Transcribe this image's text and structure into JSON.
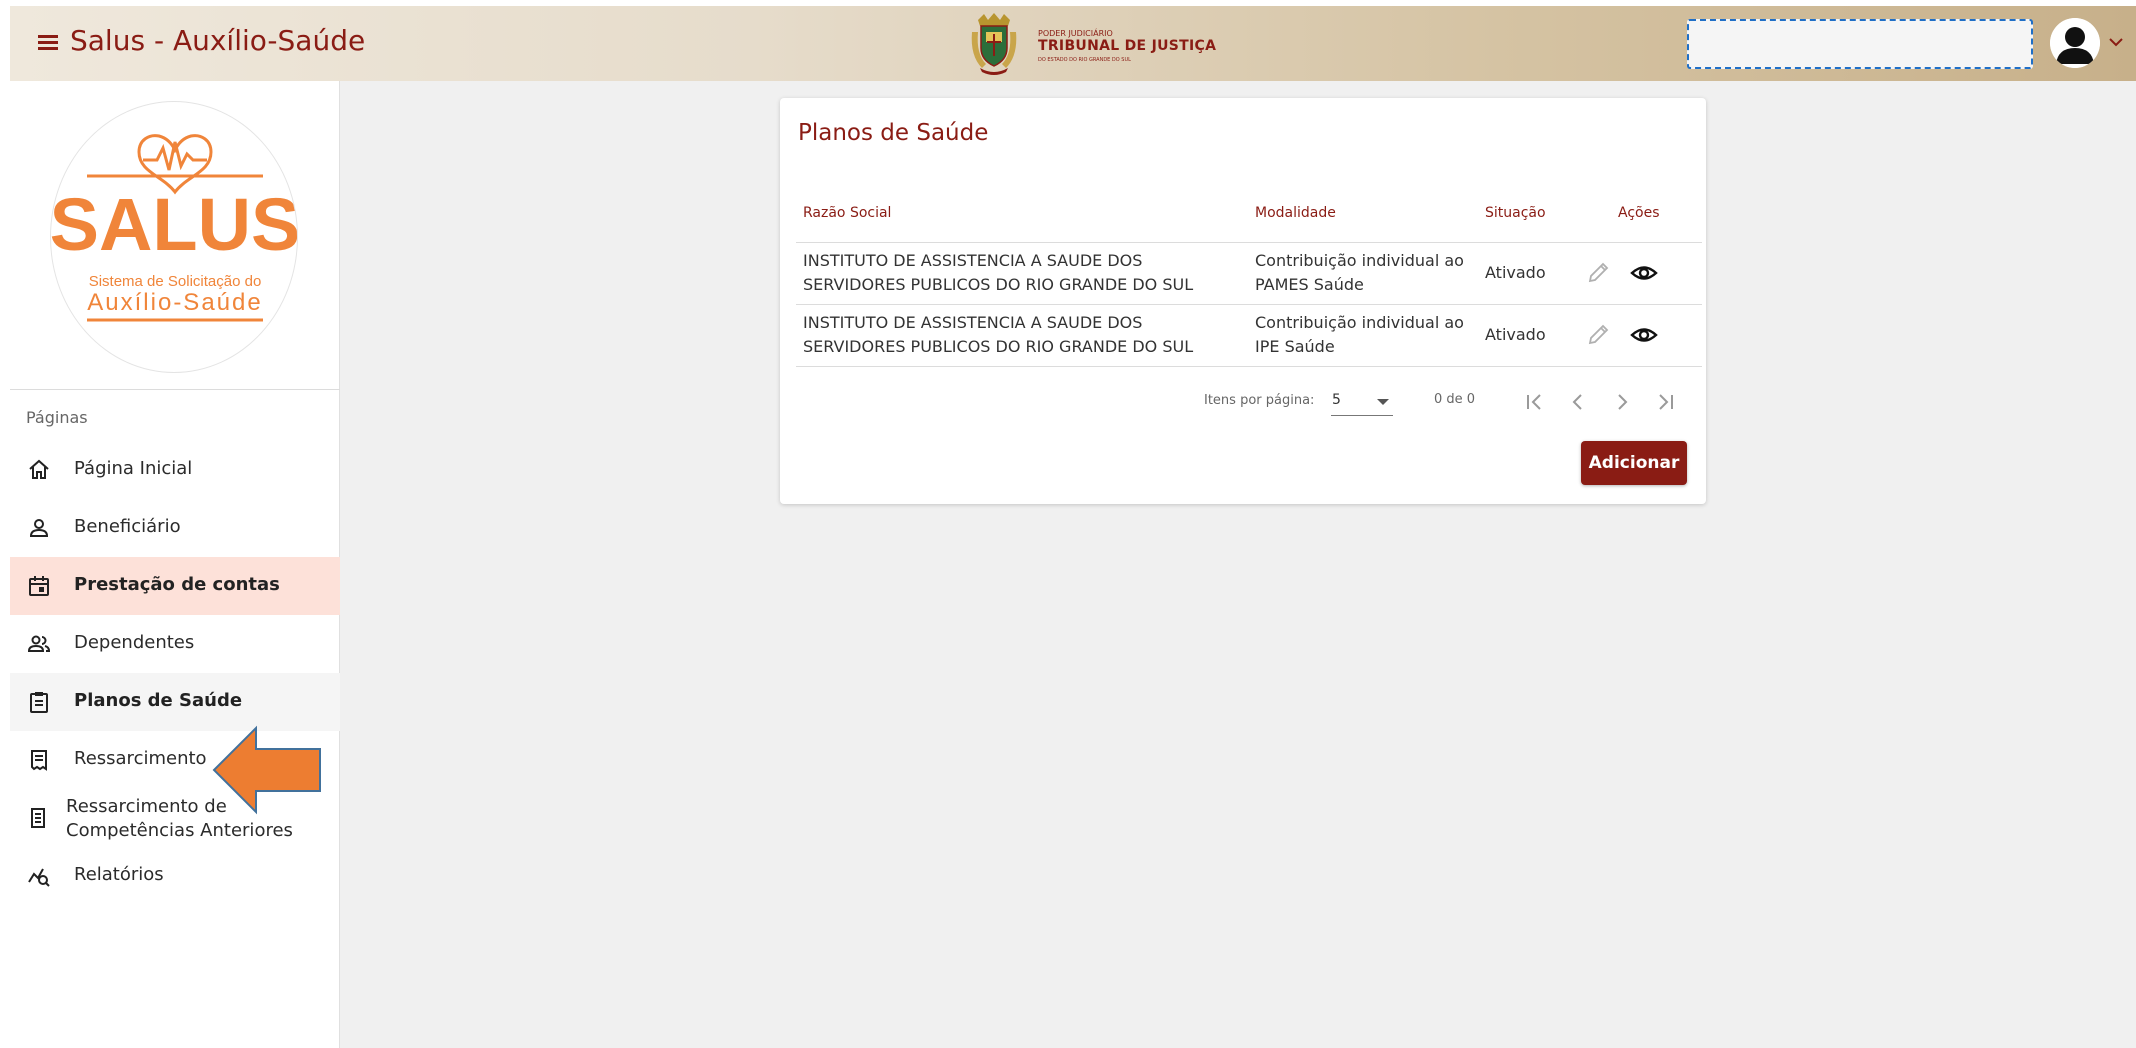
{
  "header": {
    "app_title": "Salus - Auxílio-Saúde",
    "org_line1": "PODER JUDICIÁRIO",
    "org_line2": "TRIBUNAL DE JUSTIÇA",
    "org_line3": "DO ESTADO DO RIO GRANDE DO SUL",
    "user_field_value": "",
    "icons": {
      "menu": "menu-icon",
      "avatar": "user-avatar-icon",
      "chevron": "chevron-down-icon"
    }
  },
  "logo": {
    "name": "SALUS",
    "subtitle": "Sistema de Solicitação do",
    "subtitle2": "Auxílio-Saúde",
    "color": "#f0853a"
  },
  "sidebar": {
    "heading": "Páginas",
    "items": [
      {
        "label": "Página Inicial",
        "icon": "home-icon"
      },
      {
        "label": "Beneficiário",
        "icon": "person-icon"
      },
      {
        "label": "Prestação de contas",
        "icon": "calendar-icon",
        "state": "active"
      },
      {
        "label": "Dependentes",
        "icon": "people-icon"
      },
      {
        "label": "Planos de Saúde",
        "icon": "clipboard-icon",
        "state": "current"
      },
      {
        "label": "Ressarcimento",
        "icon": "receipt-icon"
      },
      {
        "label": "Ressarcimento de",
        "label2": "Competências Anteriores",
        "icon": "list-document-icon"
      },
      {
        "label": "Relatórios",
        "icon": "chart-search-icon"
      }
    ]
  },
  "annotation": {
    "type": "arrow-left",
    "color": "#ed7d31",
    "target": "Ressarcimento"
  },
  "card": {
    "title": "Planos de Saúde",
    "columns": [
      "Razão Social",
      "Modalidade",
      "Situação",
      "Ações"
    ],
    "rows": [
      {
        "razao_social": "INSTITUTO DE ASSISTENCIA A SAUDE DOS SERVIDORES PUBLICOS DO RIO GRANDE DO SUL",
        "modalidade": "Contribuição individual ao PAMES Saúde",
        "situacao": "Ativado"
      },
      {
        "razao_social": "INSTITUTO DE ASSISTENCIA A SAUDE DOS SERVIDORES PUBLICOS DO RIO GRANDE DO SUL",
        "modalidade": "Contribuição individual ao IPE Saúde",
        "situacao": "Ativado"
      }
    ],
    "paginator": {
      "items_label": "Itens por página:",
      "page_size": "5",
      "range": "0 de 0"
    },
    "add_label": "Adicionar"
  },
  "colors": {
    "primary": "#8a1c14",
    "active_bg": "#fde1d9",
    "background": "#f0f0f0"
  }
}
